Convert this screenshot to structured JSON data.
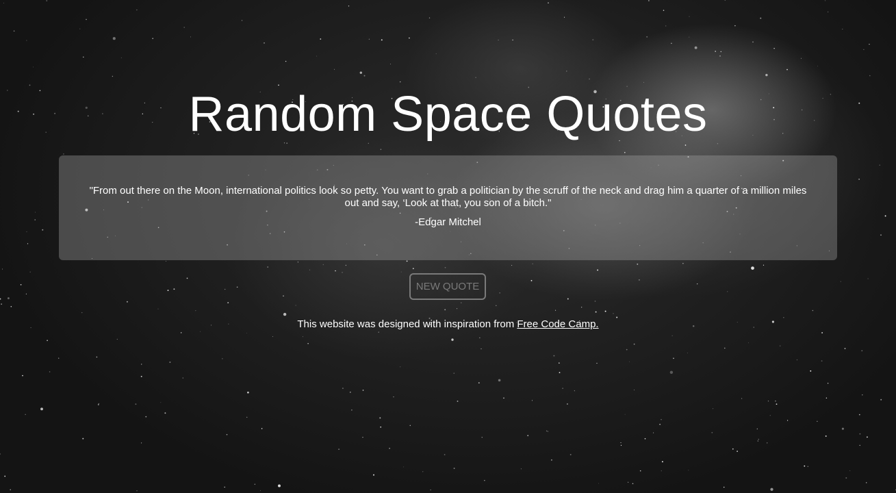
{
  "page": {
    "title": "Random Space Quotes"
  },
  "quote": {
    "text": "\"From out there on the Moon, international politics look so petty. You want to grab a politician by the scruff of the neck and drag him a quarter of a million miles out and say, ‘Look at that, you son of a bitch.\"",
    "author": "-Edgar Mitchel"
  },
  "button": {
    "new_quote_label": "NEW QUOTE"
  },
  "footer": {
    "text": "This website was designed with inspiration from ",
    "link_label": "Free Code Camp."
  },
  "colors": {
    "background": "#161616",
    "text": "#ffffff",
    "button_border": "#7a7a7a",
    "quote_box": "rgba(160,160,160,0.38)"
  }
}
